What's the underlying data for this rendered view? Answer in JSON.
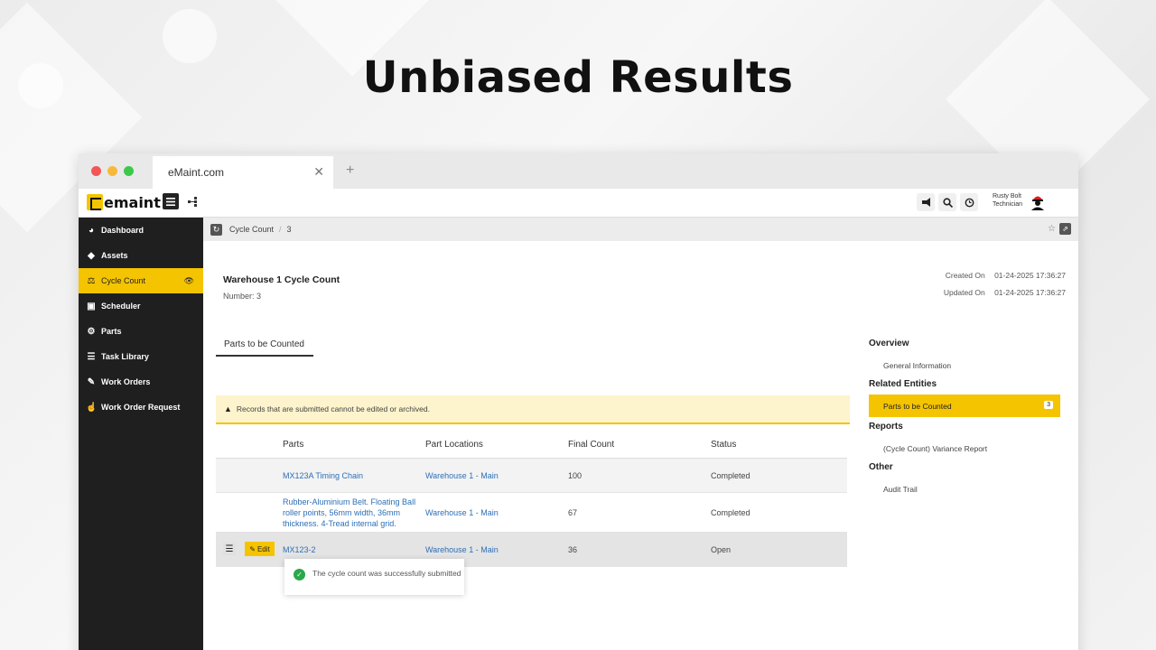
{
  "headline": "Unbiased Results",
  "browser": {
    "tab_title": "eMaint.com",
    "tab_close": "✕",
    "new_tab": "+"
  },
  "app": {
    "logo_text": "emaint",
    "user": {
      "name": "Rusty Bolt",
      "role": "Technician"
    }
  },
  "sidebar": {
    "items": [
      {
        "label": "Dashboard",
        "icon": "dashboard-icon",
        "active": false
      },
      {
        "label": "Assets",
        "icon": "cube-icon",
        "active": false
      },
      {
        "label": "Cycle Count",
        "icon": "scale-icon",
        "active": true
      },
      {
        "label": "Scheduler",
        "icon": "calendar-icon",
        "active": false
      },
      {
        "label": "Parts",
        "icon": "gears-icon",
        "active": false
      },
      {
        "label": "Task Library",
        "icon": "list-icon",
        "active": false
      },
      {
        "label": "Work Orders",
        "icon": "wrench-icon",
        "active": false
      },
      {
        "label": "Work Order Request",
        "icon": "hand-icon",
        "active": false
      }
    ]
  },
  "breadcrumb": {
    "module": "Cycle Count",
    "record": "3"
  },
  "record": {
    "title": "Warehouse 1 Cycle Count",
    "number": "Number: 3",
    "created_label": "Created On",
    "created_value": "01-24-2025 17:36:27",
    "updated_label": "Updated On",
    "updated_value": "01-24-2025 17:36:27"
  },
  "tab_label": "Parts to be Counted",
  "alert": "Records that are submitted cannot be edited or archived.",
  "table": {
    "headers": [
      "Parts",
      "Part Locations",
      "Final Count",
      "Status"
    ],
    "rows": [
      {
        "part": "MX123A Timing Chain",
        "location": "Warehouse 1 - Main",
        "count": "100",
        "status": "Completed"
      },
      {
        "part": "Rubber-Aluminium Belt. Floating Ball roller points, 56mm width, 36mm thickness. 4-Tread internal grid.",
        "location": "Warehouse 1 - Main",
        "count": "67",
        "status": "Completed"
      },
      {
        "part": "MX123-2",
        "location": "Warehouse 1 - Main",
        "count": "36",
        "status": "Open"
      }
    ],
    "edit_label": "Edit"
  },
  "right_panel": {
    "overview_head": "Overview",
    "general_info": "General Information",
    "related_head": "Related Entities",
    "related_item": "Parts to be Counted",
    "related_count": "3",
    "reports_head": "Reports",
    "report_item": "(Cycle Count) Variance Report",
    "other_head": "Other",
    "audit_trail": "Audit Trail"
  },
  "toast": "The cycle count was successfully submitted",
  "colors": {
    "accent": "#f5c400",
    "sidebar": "#1f1f1f",
    "link": "#2d6fb6"
  }
}
